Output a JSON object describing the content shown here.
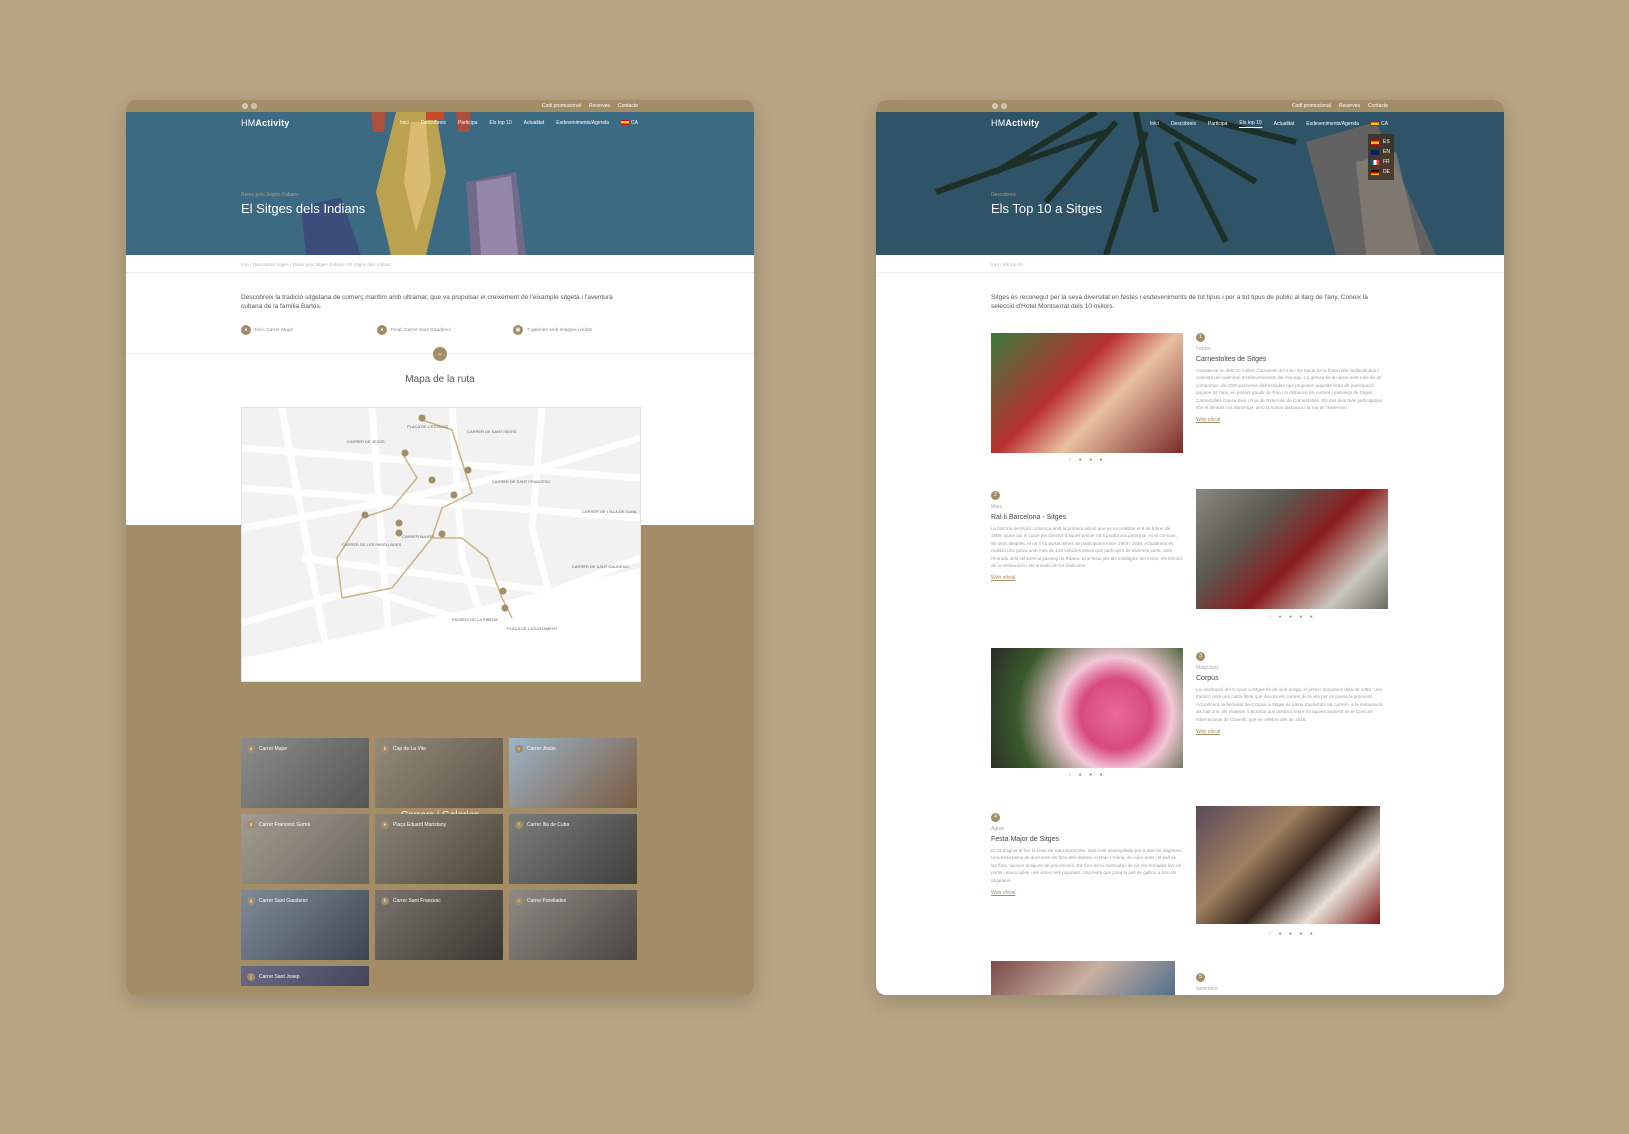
{
  "topbar": {
    "links": [
      "Codi promocional",
      "Reserves",
      "Contacte"
    ],
    "social_icons": [
      "facebook-icon",
      "instagram-icon"
    ]
  },
  "brand": {
    "logo_prefix": "HM",
    "logo_suffix": "Activity"
  },
  "nav_left": [
    "Inici",
    "Descobreix",
    "Participa",
    "Els top 10",
    "Actualitat",
    "Esdeveniments/Agenda"
  ],
  "lang_current": "CA",
  "languages": [
    "ES",
    "EN",
    "FR",
    "DE"
  ],
  "left_page": {
    "kicker": "Rutes pels Sitges d'abans",
    "title": "El Sitges dels Indians",
    "breadcrumb": "Inici  /  Descobreix Sitges  /  Rutes pels Sitges d'abans  /  El Sitges dels Indians",
    "intro": "Descobreix la tradició sitgetana de comerç marítim amb ultramar, que va propulsar el creixement de l'eixample sitgetà i l'aventura cubana de la família Bartés.",
    "meta": [
      "Inici: Carrer Major",
      "Final: Carrer Sant Gaudenci",
      "7 galeries amb imatges i relats"
    ],
    "map_title": "Mapa de la ruta",
    "map_labels": [
      "PLAÇA DE L'ESTACIÓ",
      "CARRER DE SANT ISIDRE",
      "CARRER DE JESÚS",
      "CARRER DE SANT FRANCESC",
      "CARRER DE L'ILLA DE CUBA",
      "CARRER MAJOR",
      "PASSEIG DE LA RIBERA",
      "PLAÇA DE L'AJUNTAMENT",
      "CARRER DE LES PARELLADES",
      "CARRER DE SANT GAUDENCI"
    ],
    "gallery_title": "Carrers i Galeries",
    "gallery": [
      {
        "n": "a",
        "label": "Carrer Major",
        "color": "#6f6f6f"
      },
      {
        "n": "b",
        "label": "Cap de La Vila",
        "color": "#7a7065"
      },
      {
        "n": "c",
        "label": "Carrer Jesús",
        "color": "#8a7c6a"
      },
      {
        "n": "d",
        "label": "Carrer Francesc Gumà",
        "color": "#8a8478"
      },
      {
        "n": "e",
        "label": "Plaça Eduard Maristany",
        "color": "#6c6656"
      },
      {
        "n": "f",
        "label": "Carrer Illa de Cuba",
        "color": "#6a6a62"
      },
      {
        "n": "g",
        "label": "Carrer Sant Gaudenci",
        "color": "#5f6a74"
      },
      {
        "n": "h",
        "label": "Carrer Sant Francesc",
        "color": "#5c5650"
      },
      {
        "n": "i",
        "label": "Carrer Parellades",
        "color": "#6a6560"
      },
      {
        "n": "j",
        "label": "Carrer Sant Josep",
        "color": "#55556a"
      }
    ]
  },
  "right_page": {
    "kicker": "Descobreix",
    "title": "Els Top 10 a Sitges",
    "breadcrumb": "Inici  /  Els top 10",
    "intro": "Sitges és reconegut per la seva diversitat en festes i esdeveniments de tot tipus i per a tot tipus de públic al llarg de l'any. Coneix la selecció d'Hotel Montserrat dels 10 millors.",
    "items": [
      {
        "n": "1",
        "month": "Febrer",
        "title": "Carnestoltes de Sitges",
        "body": "Considerat un dels 10 millors Carnavals del món. Es tracta de la festa més multitudinària i colorista del calendari d'esdeveniments del municipi. La gresca és al carrer amb més de 40 comparses, de 2000 persones disfressades que proposen aquesta festa de participació popular tot l'any, en posant gaudir de Rúa i la disbauxa als carrers i passeigs de Sitges. Carnestoltes Dansa Ewe i Rua de Extermini de Carnestoltes. Els dos dies més participatius són el dimarts i el diumenge, amb la nostra disbauxa i la rua de l'extermini.",
        "web": "Web oficial",
        "dots": "○ ● ● ●"
      },
      {
        "n": "2",
        "month": "Març",
        "title": "Ral·li Barcelona - Sitges",
        "body": "La història del Ral·li comença amb la primera edició que es va celebrar el 8 de febrer de 1959. Quan qui el cotxe del director d'aquell primer ral·li podria ara participar en el concurs, 60 anys després, el ral·li ha portat milers de participants entre 1959 i 1938. Actualment es realitza una prova amb més de 100 vehicles antics que participen de diverses parts, amb l'entrada dels vehicles al passeig de Ribera. Una festa per als nostàlgics del motor, els tècnics de la restauració i els amants de les tradicions.",
        "web": "Web oficial",
        "dots": "○ ● ● ● ●"
      },
      {
        "n": "3",
        "month": "Maig/Juny",
        "title": "Corpus",
        "body": "La celebració del Corpus a Sitges és de molt antiga, el primer document data de 1350. Una tradició amb una catifa floral que decora els carrers de la vila per on passa la processó. Actualment, la festivitat del Corpus a Sitges és plena d'activitats als carrers, a la restauració, als balcons, als museus. L'activitat que destaca entre tot aquest ambient és el Concurs Internacional de Clavells, que es celebra des de 1918.",
        "web": "Web oficial",
        "dots": "○ ● ● ●"
      },
      {
        "n": "4",
        "month": "Agost",
        "title": "Festa Major de Sitges",
        "body": "El 24 d'agost té lloc la festa de Sant Bartomeu, data molt assenyalada per a tots els Sitgetans. Una festa plena de duet amb els focs dels drakes, el Drac i Víbria, de color antic i el ball de les flors, danses antigues de processons. Els focs de la matinada i de nit, les tronades fan els ponts i anunciades i els actes més populars. Una festa que posa la pell de gallina a tots els Sitgetans.",
        "web": "Web oficial",
        "dots": "○ ● ● ● ●"
      },
      {
        "n": "5",
        "month": "Setembre",
        "title": "",
        "body": "",
        "web": "",
        "dots": ""
      }
    ]
  }
}
